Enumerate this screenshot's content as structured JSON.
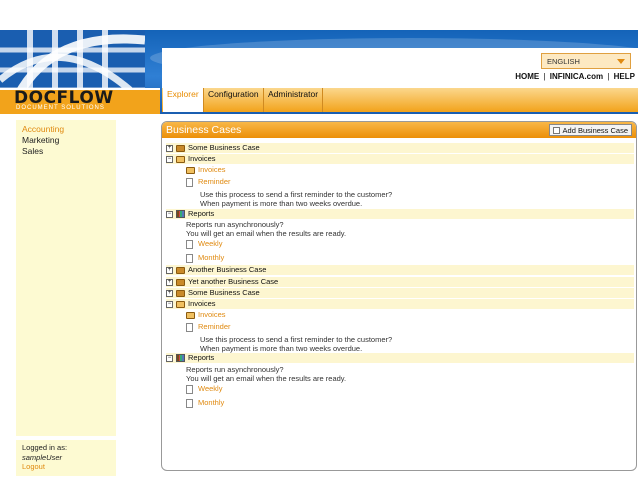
{
  "brand": {
    "name": "DOCFLOW",
    "tagline": "DOCUMENT SOLUTIONS"
  },
  "header": {
    "language": "ENGLISH",
    "links": [
      "HOME",
      "INFINICA.com",
      "HELP"
    ],
    "separator": "|"
  },
  "tabs": [
    {
      "label": "Explorer",
      "active": true
    },
    {
      "label": "Configuration",
      "active": false
    },
    {
      "label": "Administrator",
      "active": false
    }
  ],
  "sidebar": {
    "items": [
      {
        "label": "Accounting",
        "active": true
      },
      {
        "label": "Marketing",
        "active": false
      },
      {
        "label": "Sales",
        "active": false
      }
    ]
  },
  "login": {
    "label": "Logged in as:",
    "user": "sampleUser",
    "logout": "Logout"
  },
  "panel": {
    "title": "Business Cases",
    "add_button": "Add Business Case",
    "tree": {
      "some_case_1": "Some Business Case",
      "invoices_1": "Invoices",
      "invoices_1_child": "Invoices",
      "reminder_1": "Reminder",
      "reminder_desc_1_a": "Use this process to send a first reminder to the customer?",
      "reminder_desc_1_b": "When payment is more than two weeks overdue.",
      "reports_1": "Reports",
      "reports_desc_1_a": "Reports run asynchronously?",
      "reports_desc_1_b": "You will get an email when the results are ready.",
      "weekly_1": "Weekly",
      "monthly_1": "Monthly",
      "another_case": "Another Business Case",
      "yet_another_case": "Yet another Business Case",
      "some_case_2": "Some Business Case",
      "invoices_2": "Invoices",
      "invoices_2_child": "Invoices",
      "reminder_2": "Reminder",
      "reminder_desc_2_a": "Use this process to send a first reminder to the customer?",
      "reminder_desc_2_b": "When payment is more than two weeks overdue.",
      "reports_2": "Reports",
      "reports_desc_2_a": "Reports run asynchronously?",
      "reports_desc_2_b": "You will get an email when the results are ready.",
      "weekly_2": "Weekly",
      "monthly_2": "Monthly",
      "expand_symbol": "+",
      "collapse_symbol": "−"
    }
  },
  "colors": {
    "accent": "#f2a31b",
    "link": "#e08a10",
    "banner": "#1f6fc6",
    "sidebar_bg": "#fdfad2"
  }
}
